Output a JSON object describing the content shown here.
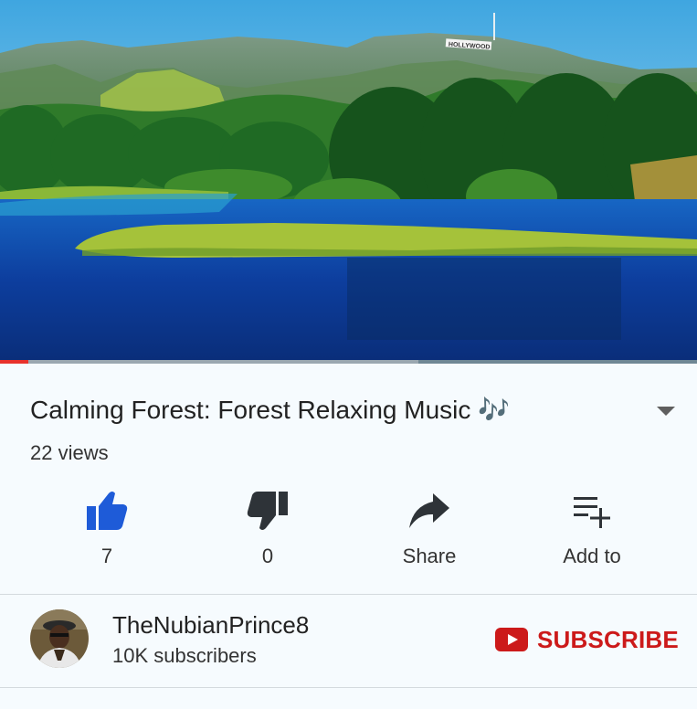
{
  "video": {
    "thumbnail_sign": "HOLLYWOOD",
    "progress_played_fraction": 0.04,
    "progress_buffered_fraction": 0.6
  },
  "details": {
    "title": "Calming Forest: Forest Relaxing Music 🎶",
    "views": "22 views"
  },
  "actions": {
    "like_count": "7",
    "dislike_count": "0",
    "share_label": "Share",
    "add_to_label": "Add to"
  },
  "channel": {
    "name": "TheNubianPrince8",
    "subscribers": "10K subscribers",
    "subscribe_label": "SUBSCRIBE"
  },
  "colors": {
    "like_active": "#1e5bd8",
    "icon_dark": "#2e3338",
    "subscribe_red": "#cc1a1a",
    "progress_played": "#e8322c"
  },
  "icons": {
    "like": "thumbs-up-icon",
    "dislike": "thumbs-down-icon",
    "share": "share-arrow-icon",
    "add_to": "playlist-add-icon",
    "subscribe": "youtube-play-icon",
    "expand": "chevron-down-icon"
  }
}
